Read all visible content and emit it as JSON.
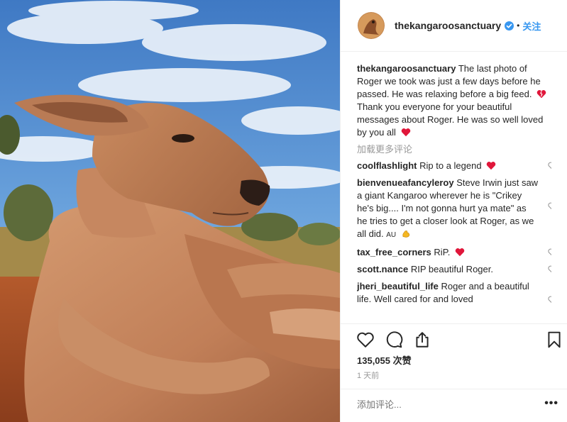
{
  "post": {
    "username": "thekangaroosanctuary",
    "separator": "•",
    "follow_label": "关注",
    "caption_line1": "The last photo of Roger we took was just a few days before he passed. He was relaxing before a big feed.",
    "caption_line2": "Thank you everyone for your beautiful messages about Roger. He was so well loved by you all",
    "load_more": "加载更多评论",
    "comments": [
      {
        "user": "coolflashlight",
        "text": "Rip to a legend"
      },
      {
        "user": "bienvenueafancyleroy",
        "text": "Steve Irwin just saw a giant Kangaroo wherever he is \"Crikey he's big.... I'm not gonna hurt ya mate\" as he tries to get a closer look at Roger, as we all did.",
        "tag": "AU"
      },
      {
        "user": "tax_free_corners",
        "text": "RiP."
      },
      {
        "user": "scott.nance",
        "text": "RIP beautiful Roger."
      },
      {
        "user": "jheri_beautiful_life",
        "text": "Roger and a beautiful life. Well cared for and loved"
      }
    ],
    "likes_count": "135,055",
    "likes_label": "次赞",
    "time_ago": "1 天前",
    "add_comment_placeholder": "添加评论...",
    "more_options": "•••"
  },
  "icons": {
    "verified": "verified-badge-icon",
    "like": "heart-outline-icon",
    "comment": "speech-bubble-icon",
    "share": "share-icon",
    "save": "bookmark-icon"
  },
  "colors": {
    "accent": "#3897f0",
    "heart_red": "#e0163a",
    "muted": "#999999",
    "text": "#262626"
  }
}
